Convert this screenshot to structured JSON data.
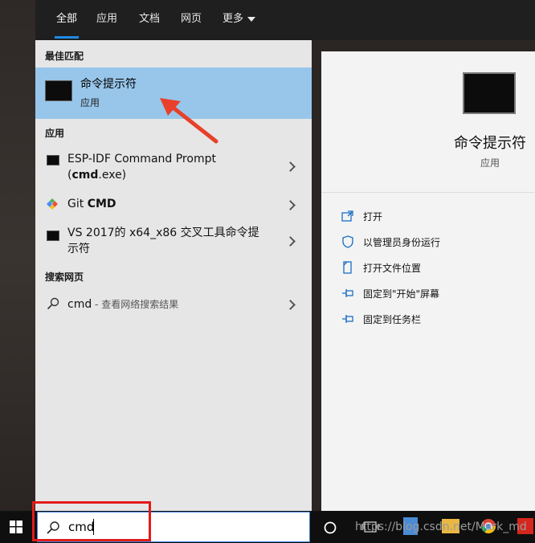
{
  "tabs": [
    "全部",
    "应用",
    "文档",
    "网页",
    "更多"
  ],
  "sections": {
    "best_match": "最佳匹配",
    "apps": "应用",
    "web": "搜索网页"
  },
  "best_match": {
    "title": "命令提示符",
    "subtitle": "应用"
  },
  "apps": [
    {
      "line1": "ESP-IDF Command Prompt",
      "bold": "cmd",
      "rest": ".exe)",
      "open": "("
    },
    {
      "prefix": "Git ",
      "bold": "CMD"
    },
    {
      "line1": "VS 2017的 x64_x86 交叉工具命令提",
      "line2": "示符"
    }
  ],
  "web_search": {
    "query": "cmd",
    "hint": " - 查看网络搜索结果"
  },
  "detail": {
    "title": "命令提示符",
    "subtitle": "应用",
    "actions": [
      "打开",
      "以管理员身份运行",
      "打开文件位置",
      "固定到\"开始\"屏幕",
      "固定到任务栏"
    ]
  },
  "taskbar": {
    "search_value": "cmd"
  },
  "watermark": "https://blog.csdn.net/Mark_md",
  "colors": {
    "accent": "#1e8ae6",
    "selected": "#98c6eb",
    "annotation": "#e21b1b"
  }
}
